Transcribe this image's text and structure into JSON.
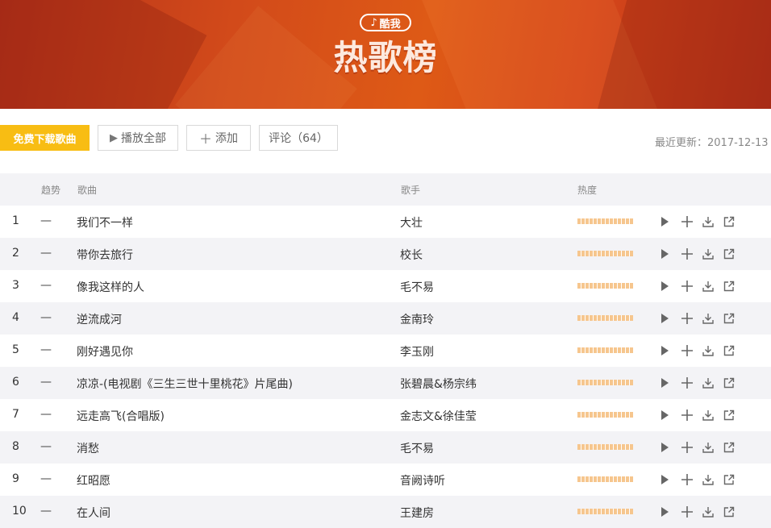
{
  "banner": {
    "brand": "酷我",
    "brand_icon": "music-note-icon",
    "title": "热歌榜"
  },
  "toolbar": {
    "download_label": "免费下载歌曲",
    "playall_label": "播放全部",
    "add_label": "添加",
    "comment_label": "评论（64）",
    "update_text": "最近更新：2017-12-13"
  },
  "table": {
    "headers": {
      "trend": "趋势",
      "song": "歌曲",
      "artist": "歌手",
      "heat": "热度"
    },
    "rows": [
      {
        "rank": "1",
        "trend": "—",
        "song": "我们不一样",
        "artist": "大壮",
        "heat": 1.0
      },
      {
        "rank": "2",
        "trend": "—",
        "song": "带你去旅行",
        "artist": "校长",
        "heat": 1.0
      },
      {
        "rank": "3",
        "trend": "—",
        "song": "像我这样的人",
        "artist": "毛不易",
        "heat": 1.0
      },
      {
        "rank": "4",
        "trend": "—",
        "song": "逆流成河",
        "artist": "金南玲",
        "heat": 1.0
      },
      {
        "rank": "5",
        "trend": "—",
        "song": "刚好遇见你",
        "artist": "李玉刚",
        "heat": 1.0
      },
      {
        "rank": "6",
        "trend": "—",
        "song": "凉凉-(电视剧《三生三世十里桃花》片尾曲)",
        "artist": "张碧晨&杨宗纬",
        "heat": 1.0
      },
      {
        "rank": "7",
        "trend": "—",
        "song": "远走高飞(合唱版)",
        "artist": "金志文&徐佳莹",
        "heat": 1.0
      },
      {
        "rank": "8",
        "trend": "—",
        "song": "消愁",
        "artist": "毛不易",
        "heat": 1.0
      },
      {
        "rank": "9",
        "trend": "—",
        "song": "红昭愿",
        "artist": "音阙诗听",
        "heat": 1.0
      },
      {
        "rank": "10",
        "trend": "—",
        "song": "在人间",
        "artist": "王建房",
        "heat": 1.0
      }
    ]
  },
  "colors": {
    "accent": "#f8bd13",
    "banner": "#de5a16",
    "row_alt": "#f3f3f6",
    "heat": "#f6c68e"
  },
  "row_actions": [
    "play-icon",
    "add-icon",
    "download-icon",
    "share-icon"
  ]
}
